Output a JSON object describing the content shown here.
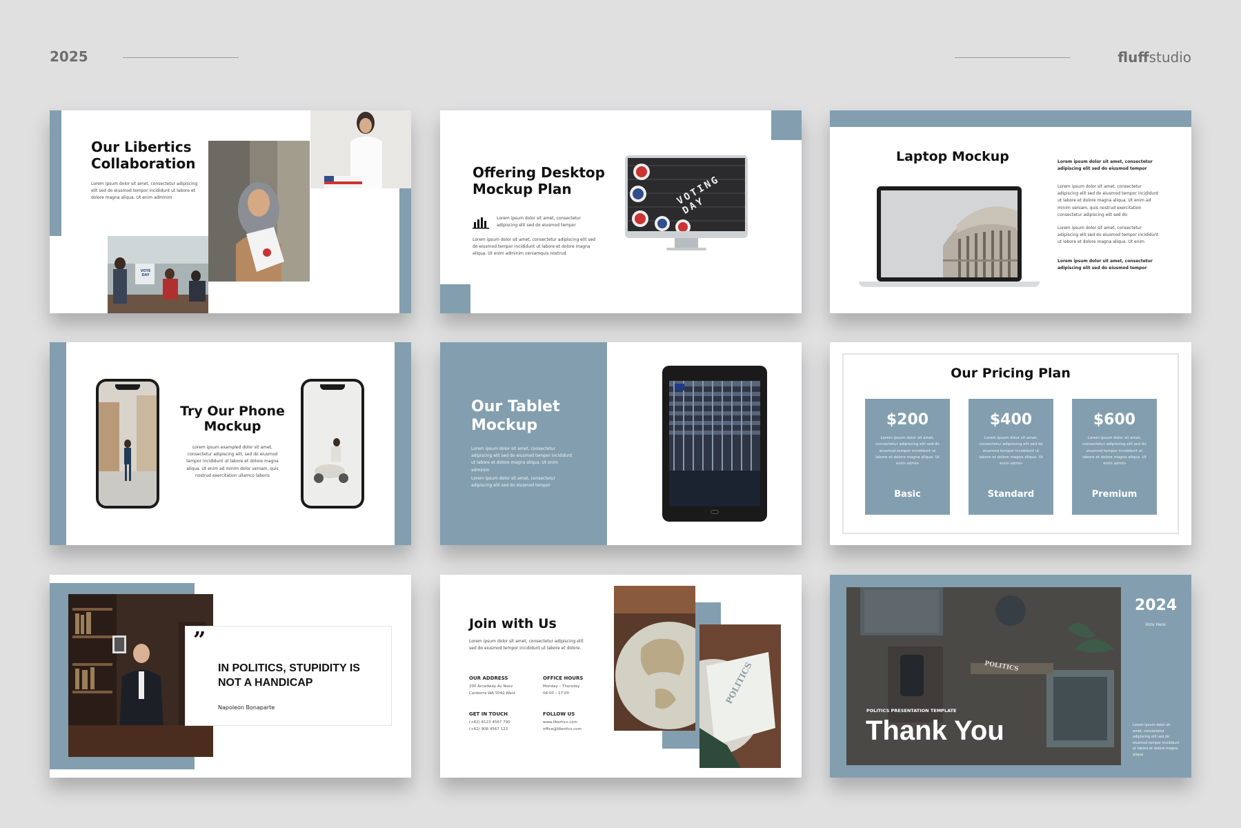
{
  "header": {
    "year": "2025",
    "brand_bold": "fluff",
    "brand_regular": "studio"
  },
  "lorem_short": "Lorem ipsum dolor sit amet, consectetur adipiscing elit sed do eiusmod tempor",
  "slides": {
    "s1": {
      "title_line1": "Our Libertics",
      "title_line2": "Collaboration",
      "body": "Lorem ipsum dolor sit amet, consectetur adipiscing elit sed do eiusmod tempor incididunt ut labore et dolore magna aliqua. Ut enim adminim",
      "sign_text": "VOTE DAY"
    },
    "s2": {
      "title_line1": "Offering Desktop",
      "title_line2": "Mockup Plan",
      "icon_text": "Lorem ipsum dolor sit amet, consectetur adipiscing elit sed do eiusmod tempor",
      "body": "Lorem ipsum dolor sit amet, consectetur adipiscing elit sed do eiusmod tempor incididunt ut labore et dolore magna aliqua. Ut enim adminim veniamquis nostrud",
      "screen_text": "VOTING DAY"
    },
    "s3": {
      "title": "Laptop Mockup",
      "p1": "Lorem ipsum dolor sit amet, consectetur adipiscing elit sed do eiusmod tempor",
      "p2": "Lorem ipsum dolor sit amet, consectetur adipiscing elit sed do eiusmod tempor incididunt ut labore et dolore magna aliqua. Ut enim ad minim veniam, quis nostrud exercitation consectetur adipiscing elit sed do",
      "p3": "Lorem ipsum dolor sit amet, consectetur adipiscing elit sed do eiusmod tempor incididunt ut labore et dolore magna aliqua. Ut enim",
      "p4": "Lorem ipsum dolor sit amet, consectetur adipiscing elit sed do eiusmod tempor"
    },
    "s4": {
      "title_line1": "Try Our Phone",
      "title_line2": "Mockup",
      "body": "Lorem ipsum exampled dolor sit amet, consectetur adipiscing elit, sed do eiusmod tempor incididunt ut labore et dolore magna aliqua. Ut enim ad minim dolor veniam, quis nostrud exercitation ullamco laboris"
    },
    "s5": {
      "title_line1": "Our Tablet",
      "title_line2": "Mockup",
      "p1": "Lorem ipsum dolor sit amet, consectetur adipiscing elit sed do eiusmod tempor incididunt ut labore et dolore magna aliqua. Ut enim adminim",
      "p2": "Lorem ipsum dolor sit amet, consectetur adipiscing elit sed do eiusmod tempor"
    },
    "s6": {
      "title": "Our Pricing Plan",
      "plans": [
        {
          "price": "$200",
          "name": "Basic",
          "desc": "Lorem ipsum dolor sit amet, consectetur adipiscing elit sed do eiusmod tempor incididunt ut labore et dolore magna aliqua. Ut enim admin"
        },
        {
          "price": "$400",
          "name": "Standard",
          "desc": "Lorem ipsum dolor sit amet, consectetur adipiscing elit sed do eiusmod tempor incididunt ut labore et dolore magna aliqua. Ut enim admin"
        },
        {
          "price": "$600",
          "name": "Premium",
          "desc": "Lorem ipsum dolor sit amet, consectetur adipiscing elit sed do eiusmod tempor incididunt ut labore et dolore magna aliqua. Ut enim admin"
        }
      ]
    },
    "s7": {
      "quote_mark": "”",
      "quote_line1": "IN POLITICS, STUPIDITY IS",
      "quote_line2": "NOT A HANDICAP",
      "author": "Napoleon Bonaparte"
    },
    "s8": {
      "title": "Join with Us",
      "body": "Lorem ipsum dolor sit amet, consectetur adipiscing elit sed do eiusmod tempor incididunt ut labore et dolore.",
      "address_label": "OUR ADDRESS",
      "address_l1": "200 Arcadway Av Nexv",
      "address_l2": "Canberra WA 5042 West",
      "hours_label": "OFFICE HOURS",
      "hours_l1": "Monday – Thursday",
      "hours_l2": "08:00 – 17:00",
      "touch_label": "GET IN TOUCH",
      "touch_l1": "(+62) 8123 4567 790",
      "touch_l2": "(+62) 908 4567 123",
      "follow_label": "FOLLOW US",
      "follow_l1": "www.libertics.com",
      "follow_l2": "office@libertics.com",
      "card_text": "POLITICS"
    },
    "s9": {
      "year": "2024",
      "vote": "Vote Here",
      "template_label": "POLITICS PRESENTATION TEMPLATE",
      "title": "Thank You",
      "body": "Lorem ipsum dolor sit amet, consectetur adipiscing elit sed do eiusmod tempor incididunt ut labore et dolore magna aliqua.",
      "tile_text": "POLITICS"
    }
  },
  "colors": {
    "accent": "#839faf",
    "background": "#e0e0e1",
    "slide": "#ffffff",
    "text": "#111111"
  }
}
